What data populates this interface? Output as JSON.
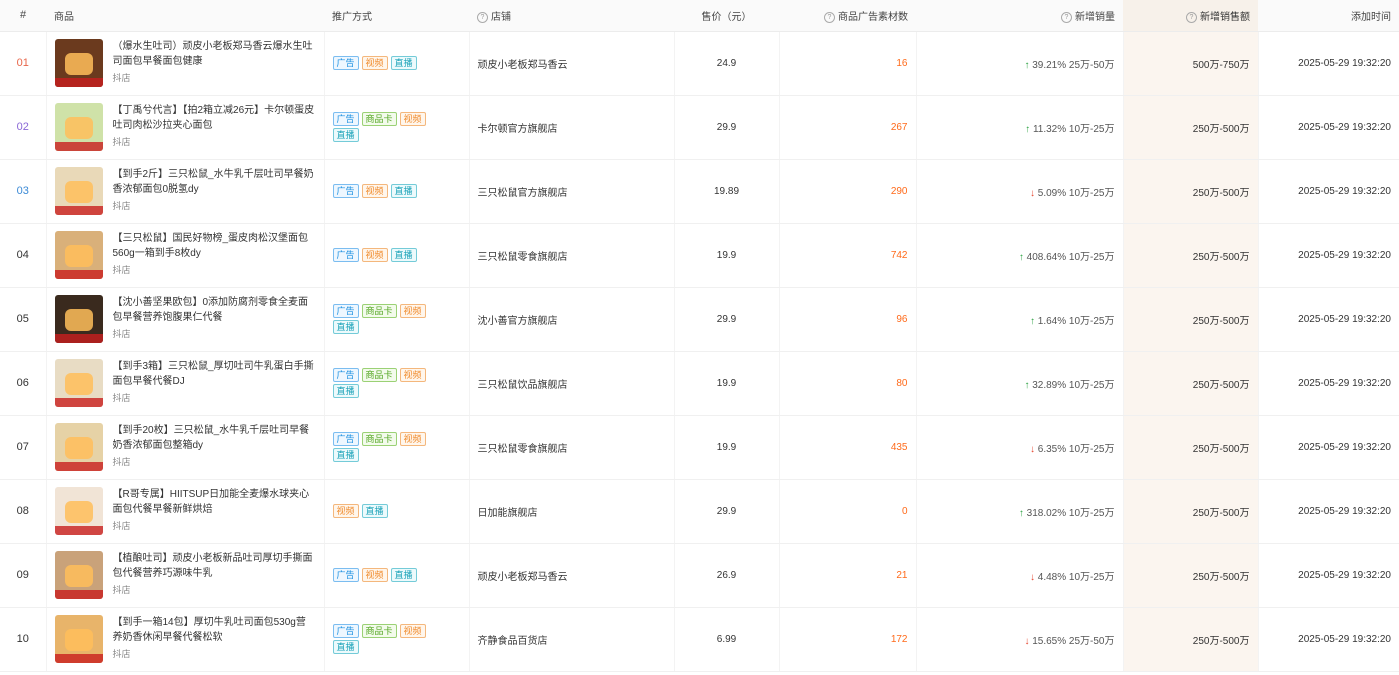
{
  "columns": {
    "index": "#",
    "product": "商品",
    "promo": "推广方式",
    "shop": "店铺",
    "price": "售价（元）",
    "ad_count": "商品广告素材数",
    "new_sales": "新增销量",
    "new_revenue": "新增销售额",
    "added_time": "添加时间"
  },
  "help_icon": "?",
  "tag_labels": {
    "ad": "广告",
    "card": "商品卡",
    "video": "视频",
    "live": "直播"
  },
  "colors": {
    "up": "#2ea344",
    "down": "#e5452e",
    "ad_count": "#ff6a1a",
    "idx_1": "#e8664a",
    "idx_2": "#8a67d6",
    "idx_3": "#3b8ad6"
  },
  "rows": [
    {
      "idx": "01",
      "title": "（爆水生吐司）顽皮小老板郑马香云爆水生吐司面包早餐面包健康",
      "platform": "抖店",
      "tags": [
        "ad",
        "video",
        "live"
      ],
      "shop": "顽皮小老板郑马香云",
      "price": "24.9",
      "ad_count": "16",
      "dir": "up",
      "growth_pct": "39.21%",
      "growth_range": "25万-50万",
      "revenue": "500万-750万",
      "time": "2025-05-29 19:32:20",
      "thumb": "#6b3a1e"
    },
    {
      "idx": "02",
      "title": "【丁禹兮代言】【拍2箱立减26元】卡尔顿蛋皮吐司肉松沙拉夹心面包",
      "platform": "抖店",
      "tags": [
        "ad",
        "card",
        "video",
        "live"
      ],
      "shop": "卡尔顿官方旗舰店",
      "price": "29.9",
      "ad_count": "267",
      "dir": "up",
      "growth_pct": "11.32%",
      "growth_range": "10万-25万",
      "revenue": "250万-500万",
      "time": "2025-05-29 19:32:20",
      "thumb": "#cfe2a8"
    },
    {
      "idx": "03",
      "title": "【到手2斤】三只松鼠_水牛乳千层吐司早餐奶香浓郁面包0脱氢dy",
      "platform": "抖店",
      "tags": [
        "ad",
        "video",
        "live"
      ],
      "shop": "三只松鼠官方旗舰店",
      "price": "19.89",
      "ad_count": "290",
      "dir": "down",
      "growth_pct": "5.09%",
      "growth_range": "10万-25万",
      "revenue": "250万-500万",
      "time": "2025-05-29 19:32:20",
      "thumb": "#e9d9b8"
    },
    {
      "idx": "04",
      "title": "【三只松鼠】国民好物榜_蛋皮肉松汉堡面包560g一箱到手8枚dy",
      "platform": "抖店",
      "tags": [
        "ad",
        "video",
        "live"
      ],
      "shop": "三只松鼠零食旗舰店",
      "price": "19.9",
      "ad_count": "742",
      "dir": "up",
      "growth_pct": "408.64%",
      "growth_range": "10万-25万",
      "revenue": "250万-500万",
      "time": "2025-05-29 19:32:20",
      "thumb": "#d9b07a"
    },
    {
      "idx": "05",
      "title": "【沈小善坚果欧包】0添加防腐剂零食全麦面包早餐营养饱腹果仁代餐",
      "platform": "抖店",
      "tags": [
        "ad",
        "card",
        "video",
        "live"
      ],
      "shop": "沈小善官方旗舰店",
      "price": "29.9",
      "ad_count": "96",
      "dir": "up",
      "growth_pct": "1.64%",
      "growth_range": "10万-25万",
      "revenue": "250万-500万",
      "time": "2025-05-29 19:32:20",
      "thumb": "#3a2a1e"
    },
    {
      "idx": "06",
      "title": "【到手3箱】三只松鼠_厚切吐司牛乳蛋白手撕面包早餐代餐DJ",
      "platform": "抖店",
      "tags": [
        "ad",
        "card",
        "video",
        "live"
      ],
      "shop": "三只松鼠饮品旗舰店",
      "price": "19.9",
      "ad_count": "80",
      "dir": "up",
      "growth_pct": "32.89%",
      "growth_range": "10万-25万",
      "revenue": "250万-500万",
      "time": "2025-05-29 19:32:20",
      "thumb": "#e8dcc4"
    },
    {
      "idx": "07",
      "title": "【到手20枚】三只松鼠_水牛乳千层吐司早餐奶香浓郁面包整箱dy",
      "platform": "抖店",
      "tags": [
        "ad",
        "card",
        "video",
        "live"
      ],
      "shop": "三只松鼠零食旗舰店",
      "price": "19.9",
      "ad_count": "435",
      "dir": "down",
      "growth_pct": "6.35%",
      "growth_range": "10万-25万",
      "revenue": "250万-500万",
      "time": "2025-05-29 19:32:20",
      "thumb": "#e6d2a6"
    },
    {
      "idx": "08",
      "title": "【R哥专属】HIITSUP日加能全麦爆水球夹心面包代餐早餐新鲜烘焙",
      "platform": "抖店",
      "tags": [
        "video",
        "live"
      ],
      "shop": "日加能旗舰店",
      "price": "29.9",
      "ad_count": "0",
      "dir": "up",
      "growth_pct": "318.02%",
      "growth_range": "10万-25万",
      "revenue": "250万-500万",
      "time": "2025-05-29 19:32:20",
      "thumb": "#f1e4d6"
    },
    {
      "idx": "09",
      "title": "【植酿吐司】顽皮小老板新品吐司厚切手撕面包代餐营养巧源味牛乳",
      "platform": "抖店",
      "tags": [
        "ad",
        "video",
        "live"
      ],
      "shop": "顽皮小老板郑马香云",
      "price": "26.9",
      "ad_count": "21",
      "dir": "down",
      "growth_pct": "4.48%",
      "growth_range": "10万-25万",
      "revenue": "250万-500万",
      "time": "2025-05-29 19:32:20",
      "thumb": "#c9a27a"
    },
    {
      "idx": "10",
      "title": "【到手一箱14包】厚切牛乳吐司面包530g营养奶香休闲早餐代餐松软",
      "platform": "抖店",
      "tags": [
        "ad",
        "card",
        "video",
        "live"
      ],
      "shop": "齐静食品百货店",
      "price": "6.99",
      "ad_count": "172",
      "dir": "down",
      "growth_pct": "15.65%",
      "growth_range": "25万-50万",
      "revenue": "250万-500万",
      "time": "2025-05-29 19:32:20",
      "thumb": "#e8b46a"
    }
  ]
}
